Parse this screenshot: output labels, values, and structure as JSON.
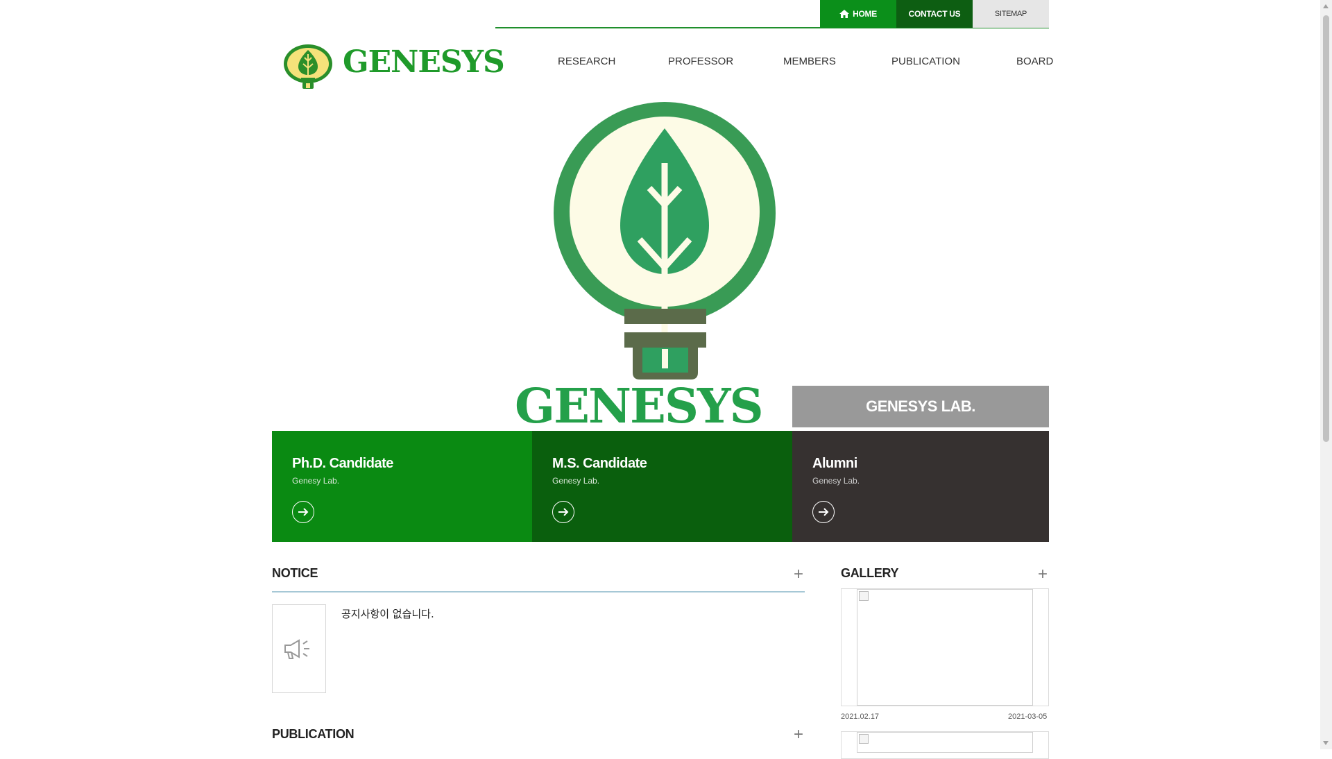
{
  "util": {
    "home": "HOME",
    "contact": "CONTACT US",
    "sitemap": "SITEMAP"
  },
  "brand": {
    "logo_text": "GENESYS"
  },
  "nav": [
    "RESEARCH",
    "PROFESSOR",
    "MEMBERS",
    "PUBLICATION",
    "BOARD"
  ],
  "hero": {
    "logo_text": "GENESYS",
    "label": "GENESYS LAB."
  },
  "cards": [
    {
      "title": "Ph.D. Candidate",
      "sub": "Genesy Lab."
    },
    {
      "title": "M.S. Candidate",
      "sub": "Genesy Lab."
    },
    {
      "title": "Alumni",
      "sub": "Genesy Lab."
    }
  ],
  "notice": {
    "title": "NOTICE",
    "empty": "공지사항이 없습니다."
  },
  "publication": {
    "title": "PUBLICATION"
  },
  "gallery": {
    "title": "GALLERY",
    "date_left": "2021.02.17",
    "date_right": "2021-03-05"
  },
  "colors": {
    "primary_green": "#0b8f1a",
    "dark_green": "#0d5e12",
    "alumni": "#363130",
    "hero_label_bg": "#999999"
  }
}
